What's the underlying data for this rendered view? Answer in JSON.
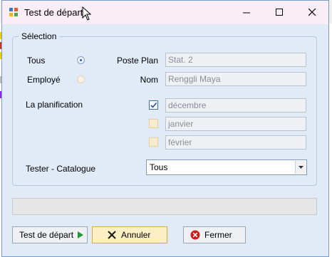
{
  "window": {
    "title": "Test de départ",
    "controls": {
      "minimize": "minimize-icon",
      "maximize": "maximize-icon",
      "close": "close-icon"
    }
  },
  "group": {
    "title": "Sélection"
  },
  "mode": {
    "all_label": "Tous",
    "employee_label": "Employé",
    "selected": "all"
  },
  "post_plan": {
    "label": "Poste Plan",
    "value": "Stat. 2"
  },
  "name": {
    "label": "Nom",
    "value": "Renggli Maya"
  },
  "planning": {
    "label": "La planification",
    "months": [
      {
        "label": "décembre",
        "checked": true
      },
      {
        "label": "janvier",
        "checked": false
      },
      {
        "label": "février",
        "checked": false
      }
    ]
  },
  "catalogue": {
    "label": "Tester - Catalogue",
    "selected": "Tous"
  },
  "progress": {
    "value": 0
  },
  "buttons": {
    "start": "Test de départ",
    "cancel": "Annuler",
    "close": "Fermer"
  },
  "colors": {
    "title_bg": "#f9edf6",
    "window_bg": "#e0ebf7",
    "accent": "#2b64b8",
    "hot_button": "#fcefc3",
    "close_red": "#d11a1a"
  }
}
